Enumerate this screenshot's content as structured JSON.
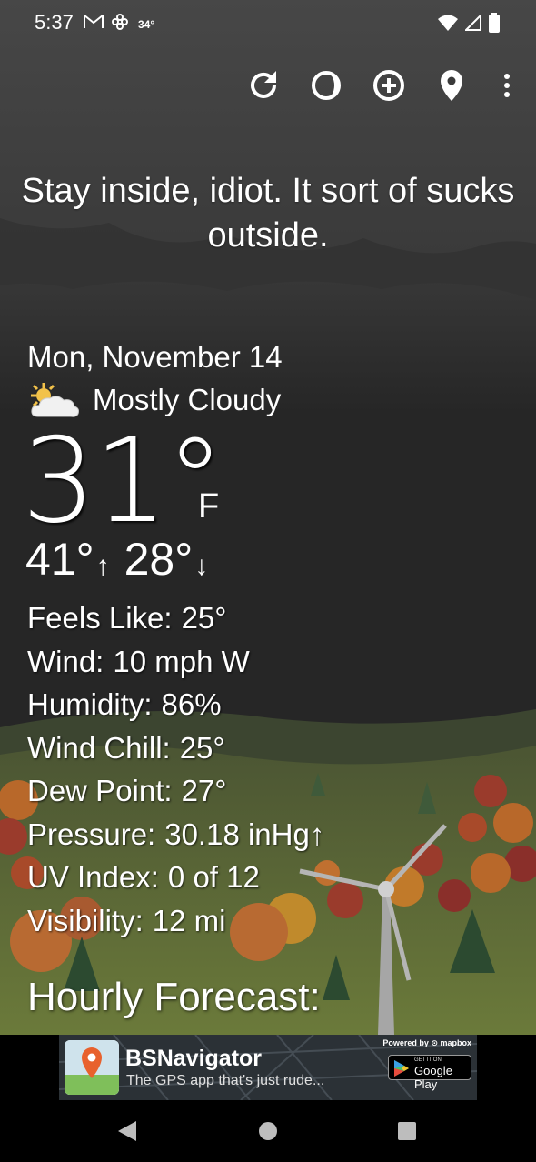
{
  "status": {
    "time": "5:37",
    "temp": "34°"
  },
  "toolbar": {
    "icons": [
      "refresh-icon",
      "theme-icon",
      "add-location-icon",
      "location-pin-icon",
      "more-vert-icon"
    ]
  },
  "tagline": "Stay inside, idiot. It sort of sucks outside.",
  "weather": {
    "date": "Mon, November 14",
    "condition": "Mostly Cloudy",
    "temperature": "31°",
    "unit": "F",
    "high": "41°",
    "high_arrow": "↑",
    "low": "28°",
    "low_arrow": "↓"
  },
  "details": [
    {
      "label": "Feels Like:",
      "value": "25°"
    },
    {
      "label": "Wind:",
      "value": "10 mph W"
    },
    {
      "label": "Humidity:",
      "value": "86%"
    },
    {
      "label": "Wind Chill:",
      "value": "25°"
    },
    {
      "label": "Dew Point:",
      "value": "27°"
    },
    {
      "label": "Pressure:",
      "value": "30.18 inHg↑"
    },
    {
      "label": "UV Index:",
      "value": "0 of 12"
    },
    {
      "label": "Visibility:",
      "value": "12 mi"
    }
  ],
  "hourly_title": "Hourly Forecast:",
  "ad": {
    "title": "BSNavigator",
    "subtitle": "The GPS app that's just rude...",
    "powered_by": "Powered by ⊙ mapbox",
    "store_small": "GET IT ON",
    "store_big": "Google Play"
  },
  "colors": {
    "sky": "#3e3e3e",
    "hill": "#5d6b35",
    "tree_orange": "#b8682a",
    "tree_red": "#8a2f2a"
  }
}
